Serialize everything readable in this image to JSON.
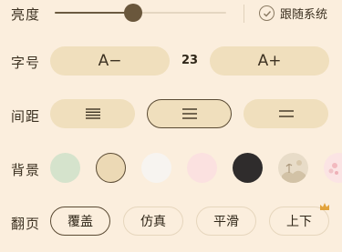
{
  "brightness": {
    "label": "亮度",
    "level": 0.46,
    "follow_system_label": "跟随系统",
    "follow_system_checked": true
  },
  "font_size": {
    "label": "字号",
    "decrease_label": "A−",
    "increase_label": "A+",
    "value": "23"
  },
  "spacing": {
    "label": "间距",
    "options": [
      "compact",
      "normal",
      "loose"
    ],
    "selected": "normal"
  },
  "background": {
    "label": "背景",
    "swatches": [
      {
        "name": "green",
        "color": "#d5e3cc"
      },
      {
        "name": "parchment",
        "color": "#ecd9b5"
      },
      {
        "name": "white",
        "color": "#f7f4f0"
      },
      {
        "name": "pink",
        "color": "#fbe1e0"
      },
      {
        "name": "black",
        "color": "#2f2c2c"
      },
      {
        "name": "landscape",
        "color": "#e8dcc8"
      },
      {
        "name": "blossom",
        "color": "#fbe4e4"
      }
    ],
    "selected": "parchment"
  },
  "page_turn": {
    "label": "翻页",
    "options": [
      "覆盖",
      "仿真",
      "平滑",
      "上下"
    ],
    "selected": "覆盖"
  },
  "colors": {
    "accent": "#5a4a33",
    "pill_bg": "#f0dfbd",
    "page_bg": "#fbeedd"
  }
}
